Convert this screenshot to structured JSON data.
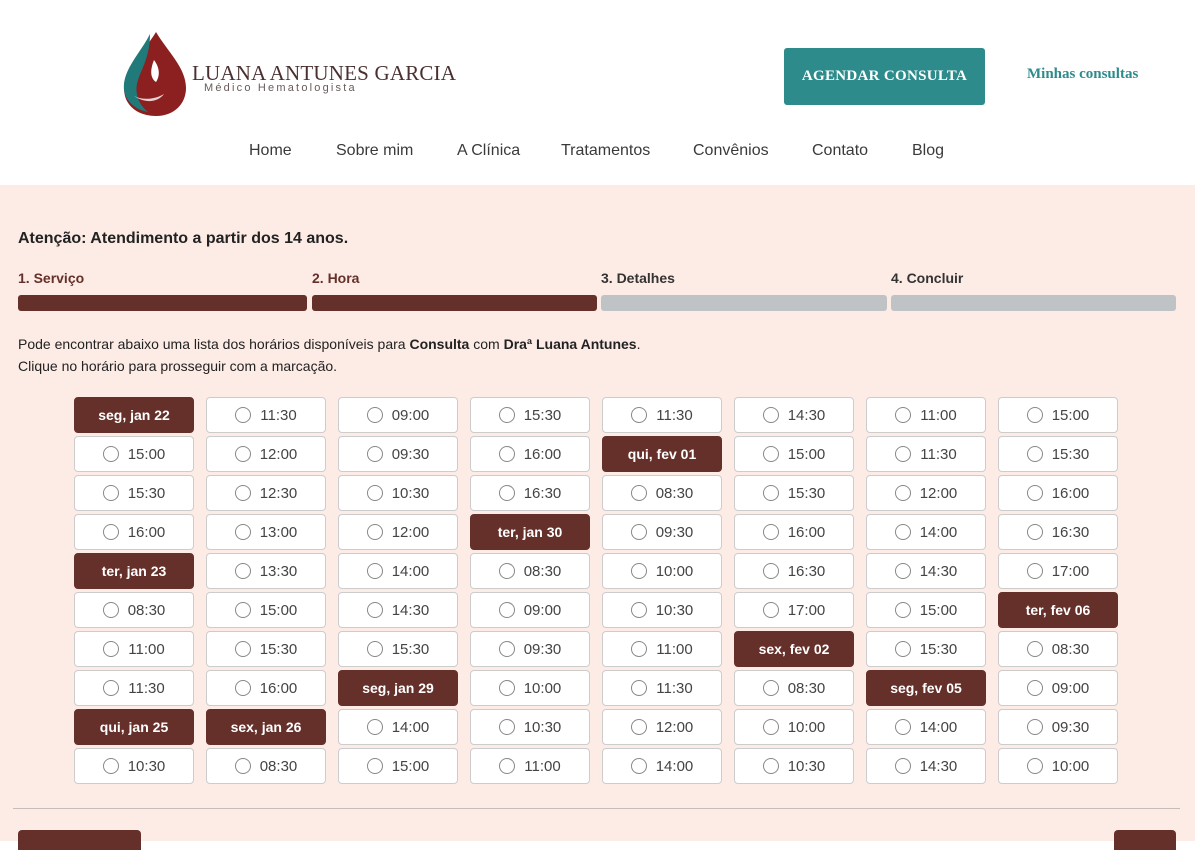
{
  "header": {
    "logo_name": "LUANA ANTUNES GARCIA",
    "logo_sub": "Médico Hematologista",
    "cta_label": "AGENDAR CONSULTA",
    "my_appointments": "Minhas consultas"
  },
  "nav": [
    "Home",
    "Sobre mim",
    "A Clínica",
    "Tratamentos",
    "Convênios",
    "Contato",
    "Blog"
  ],
  "attention": "Atenção: Atendimento a partir dos 14 anos.",
  "steps": [
    {
      "label": "1. Serviço",
      "state": "done"
    },
    {
      "label": "2. Hora",
      "state": "done"
    },
    {
      "label": "3. Detalhes",
      "state": "todo"
    },
    {
      "label": "4. Concluir",
      "state": "todo"
    }
  ],
  "description": {
    "line1_prefix": "Pode encontrar abaixo uma lista dos horários disponíveis para ",
    "service": "Consulta",
    "line1_mid": " com ",
    "doctor": "Draª Luana Antunes",
    "line1_suffix": ".",
    "line2": "Clique no horário para prosseguir com a marcação."
  },
  "colors": {
    "brand_dark": "#66302a",
    "teal": "#2e8b8c",
    "step_inactive": "#bfc3c6",
    "background": "#fdece6"
  },
  "schedule_columns": [
    [
      {
        "date": "seg, jan 22"
      },
      "15:00",
      "15:30",
      "16:00",
      {
        "date": "ter, jan 23"
      },
      "08:30",
      "11:00",
      "11:30",
      {
        "date": "qui, jan 25"
      },
      "10:30"
    ],
    [
      "11:30",
      "12:00",
      "12:30",
      "13:00",
      "13:30",
      "15:00",
      "15:30",
      "16:00",
      {
        "date": "sex, jan 26"
      },
      "08:30"
    ],
    [
      "09:00",
      "09:30",
      "10:30",
      "12:00",
      "14:00",
      "14:30",
      "15:30",
      {
        "date": "seg, jan 29"
      },
      "14:00",
      "15:00"
    ],
    [
      "15:30",
      "16:00",
      "16:30",
      {
        "date": "ter, jan 30"
      },
      "08:30",
      "09:00",
      "09:30",
      "10:00",
      "10:30",
      "11:00"
    ],
    [
      "11:30",
      {
        "date": "qui, fev 01"
      },
      "08:30",
      "09:30",
      "10:00",
      "10:30",
      "11:00",
      "11:30",
      "12:00",
      "14:00"
    ],
    [
      "14:30",
      "15:00",
      "15:30",
      "16:00",
      "16:30",
      "17:00",
      {
        "date": "sex, fev 02"
      },
      "08:30",
      "10:00",
      "10:30"
    ],
    [
      "11:00",
      "11:30",
      "12:00",
      "14:00",
      "14:30",
      "15:00",
      "15:30",
      {
        "date": "seg, fev 05"
      },
      "14:00",
      "14:30"
    ],
    [
      "15:00",
      "15:30",
      "16:00",
      "16:30",
      "17:00",
      {
        "date": "ter, fev 06"
      },
      "08:30",
      "09:00",
      "09:30",
      "10:00"
    ]
  ]
}
